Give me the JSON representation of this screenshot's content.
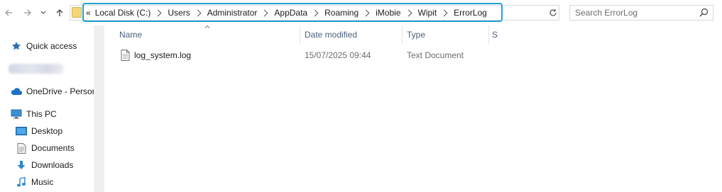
{
  "address": {
    "overflow": "«",
    "crumbs": [
      "Local Disk (C:)",
      "Users",
      "Administrator",
      "AppData",
      "Roaming",
      "iMobie",
      "Wipit",
      "ErrorLog"
    ]
  },
  "search": {
    "placeholder": "Search ErrorLog"
  },
  "sidebar": {
    "quick_access": "Quick access",
    "onedrive": "OneDrive - Persor",
    "this_pc": "This PC",
    "desktop": "Desktop",
    "documents": "Documents",
    "downloads": "Downloads",
    "music": "Music"
  },
  "columns": {
    "name": "Name",
    "date": "Date modified",
    "type": "Type",
    "size": "S"
  },
  "files": [
    {
      "name": "log_system.log",
      "date": "15/07/2025 09:44",
      "type": "Text Document"
    }
  ],
  "colors": {
    "highlight": "#1fa3d6",
    "header_text": "#4c607a"
  }
}
